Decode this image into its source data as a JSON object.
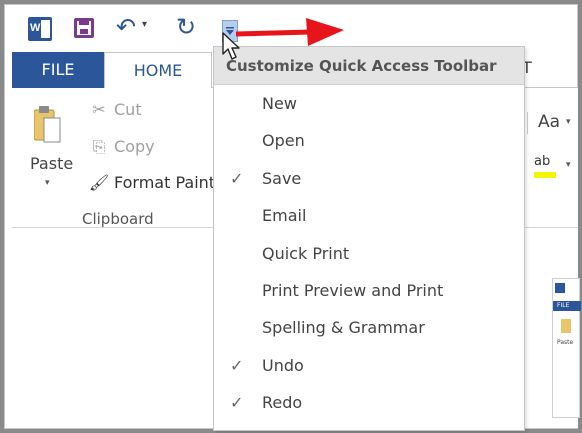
{
  "qat": {
    "word_icon": "word-app-icon",
    "word_letter": "W",
    "save_icon": "save-icon",
    "undo_icon": "undo-icon",
    "undo_glyph": "↶",
    "redo_icon": "redo-icon",
    "redo_glyph": "↻",
    "customize_icon": "chevron-down-icon",
    "dropdown_caret": "▾"
  },
  "tabs": [
    {
      "label": "FILE",
      "active": false
    },
    {
      "label": "HOME",
      "active": true
    },
    {
      "label": "T",
      "active": false
    }
  ],
  "clipboard": {
    "paste_label": "Paste",
    "cut_label": "Cut",
    "copy_label": "Copy",
    "format_painter_label": "Format Paint",
    "group_label": "Clipboard",
    "cut_glyph": "✂",
    "copy_glyph": "⎘",
    "brush_glyph": "🖌"
  },
  "font_group": {
    "change_case_label": "Aa",
    "highlight_label": "ab"
  },
  "menu": {
    "title": "Customize Quick Access Toolbar",
    "check_glyph": "✓",
    "items": [
      {
        "label": "New",
        "checked": false
      },
      {
        "label": "Open",
        "checked": false
      },
      {
        "label": "Save",
        "checked": true
      },
      {
        "label": "Email",
        "checked": false
      },
      {
        "label": "Quick Print",
        "checked": false
      },
      {
        "label": "Print Preview and Print",
        "checked": false
      },
      {
        "label": "Spelling & Grammar",
        "checked": false
      },
      {
        "label": "Undo",
        "checked": true
      },
      {
        "label": "Redo",
        "checked": true
      }
    ]
  },
  "thumbnail": {
    "file_label": "FILE",
    "paste_label": "Paste"
  },
  "colors": {
    "word_blue": "#2b579a",
    "save_purple": "#7a3b8f",
    "annotation_red": "#e8141b",
    "menu_header_bg": "#e4e4e4",
    "highlight_yellow": "#f5f500"
  }
}
